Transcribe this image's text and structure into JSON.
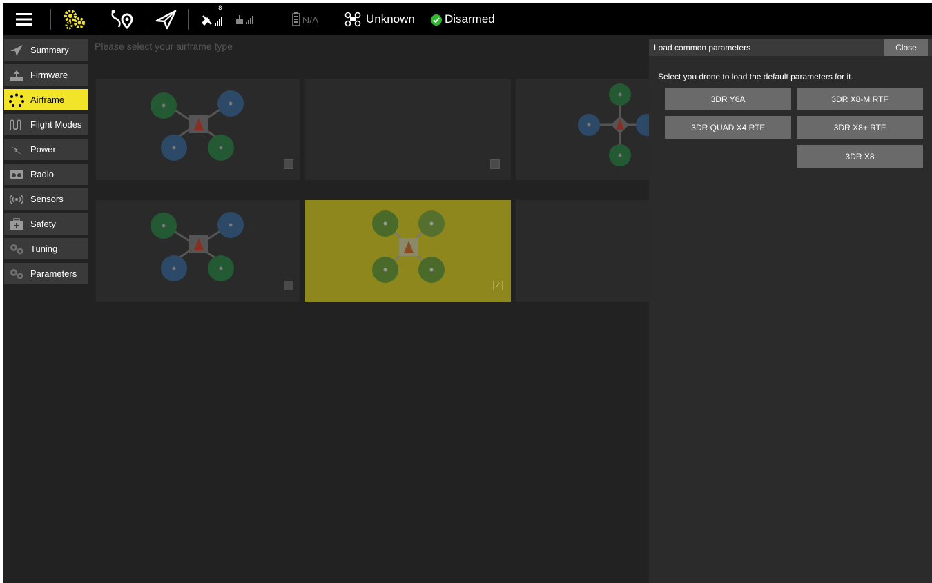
{
  "toolbar": {
    "battery_text": "N/A",
    "gps_count": "8",
    "flight_mode": "Unknown",
    "arm_status": "Disarmed",
    "accent_color": "#f2e428",
    "arm_ok_color": "#2eb82e"
  },
  "sidebar": {
    "items": [
      {
        "label": "Summary",
        "icon": "paper-plane-icon"
      },
      {
        "label": "Firmware",
        "icon": "firmware-upload-icon"
      },
      {
        "label": "Airframe",
        "icon": "airframe-dots-icon",
        "active": true
      },
      {
        "label": "Flight Modes",
        "icon": "flight-modes-wave-icon"
      },
      {
        "label": "Power",
        "icon": "power-bolt-icon"
      },
      {
        "label": "Radio",
        "icon": "radio-icon"
      },
      {
        "label": "Sensors",
        "icon": "sensors-icon"
      },
      {
        "label": "Safety",
        "icon": "first-aid-icon"
      },
      {
        "label": "Tuning",
        "icon": "tuning-gears-icon"
      },
      {
        "label": "Parameters",
        "icon": "parameters-gears-icon"
      }
    ]
  },
  "main": {
    "title": "Please select your airframe type",
    "selected_card_color": "#8d871e"
  },
  "panel": {
    "title": "Load common parameters",
    "close_label": "Close",
    "description": "Select you drone to load the default parameters for it.",
    "presets": [
      "3DR Y6A",
      "3DR X8-M RTF",
      "3DR QUAD X4 RTF",
      "3DR X8+ RTF",
      "3DR X8"
    ]
  }
}
